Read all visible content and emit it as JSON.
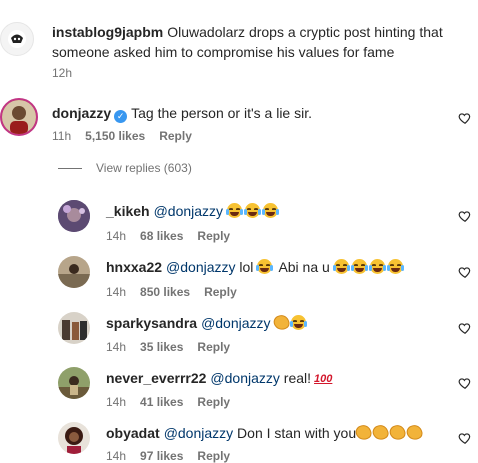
{
  "post": {
    "username": "instablog9japbm",
    "caption": "Oluwadolarz drops a cryptic post hinting that someone asked him to compromise his values for fame",
    "time": "12h"
  },
  "comments": [
    {
      "username": "donjazzy",
      "verified": true,
      "text": "Tag the person or it's a lie sir.",
      "time": "11h",
      "likes": "5,150 likes",
      "reply_label": "Reply"
    }
  ],
  "view_replies": "View replies (603)",
  "replies": [
    {
      "username": "_kikeh",
      "mention": "@donjazzy",
      "text": "",
      "emoji": [
        "joy-emoji",
        "joy-emoji",
        "joy-emoji"
      ],
      "time": "14h",
      "likes": "68 likes",
      "reply_label": "Reply"
    },
    {
      "username": "hnxxa22",
      "mention": "@donjazzy",
      "text": "lol",
      "emoji_mid": [
        "joy-emoji"
      ],
      "text2": "Abi na u",
      "emoji": [
        "joy-emoji",
        "joy-emoji",
        "joy-emoji",
        "joy-emoji"
      ],
      "time": "14h",
      "likes": "850 likes",
      "reply_label": "Reply"
    },
    {
      "username": "sparkysandra",
      "mention": "@donjazzy",
      "text": "",
      "emoji": [
        "clap-emoji",
        "joy-emoji"
      ],
      "time": "14h",
      "likes": "35 likes",
      "reply_label": "Reply"
    },
    {
      "username": "never_everrr22",
      "mention": "@donjazzy",
      "text": "real!",
      "emoji": [
        "hundred-emoji"
      ],
      "time": "14h",
      "likes": "41 likes",
      "reply_label": "Reply"
    },
    {
      "username": "obyadat",
      "mention": "@donjazzy",
      "text": "Don I stan with you",
      "emoji": [
        "clap-emoji",
        "clap-emoji",
        "clap-emoji",
        "clap-emoji"
      ],
      "time": "14h",
      "likes": "97 likes",
      "reply_label": "Reply"
    }
  ],
  "colors": {
    "mention": "#00376b",
    "secondary": "#737373",
    "verified": "#3897f0"
  },
  "icons": {
    "like": "heart-icon"
  }
}
